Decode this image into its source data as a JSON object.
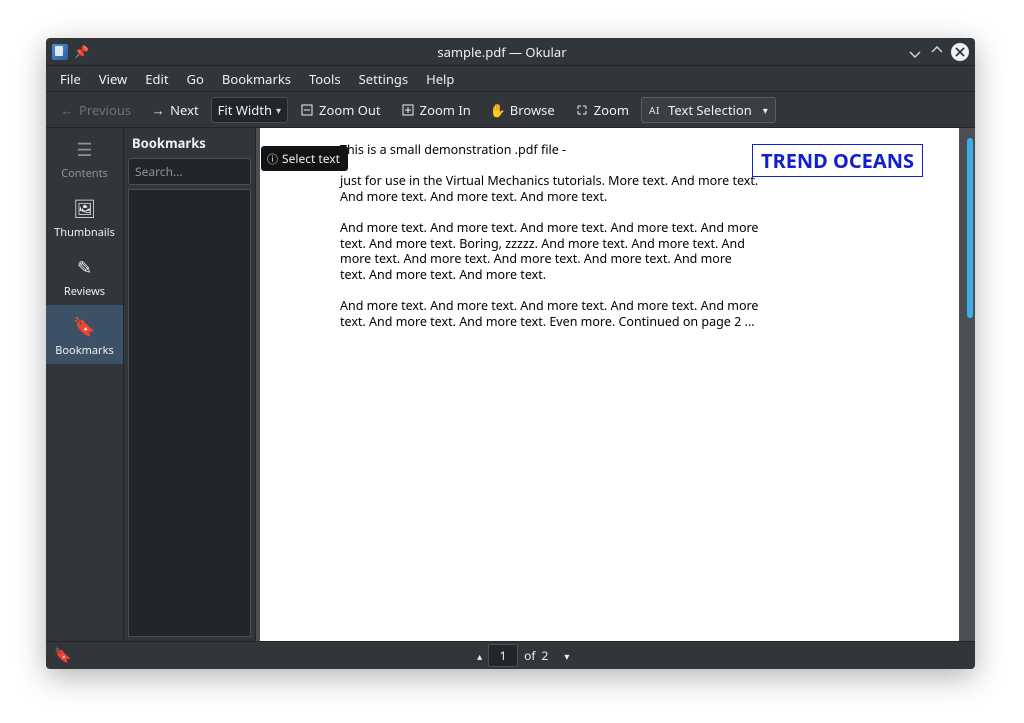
{
  "window": {
    "title": "sample.pdf — Okular"
  },
  "menubar": [
    "File",
    "View",
    "Edit",
    "Go",
    "Bookmarks",
    "Tools",
    "Settings",
    "Help"
  ],
  "toolbar": {
    "previous": "Previous",
    "next": "Next",
    "zoom_mode": "Fit Width",
    "zoom_out": "Zoom Out",
    "zoom_in": "Zoom In",
    "browse": "Browse",
    "zoom": "Zoom",
    "text_selection": "Text Selection"
  },
  "sidebar": {
    "items": [
      {
        "label": "Contents"
      },
      {
        "label": "Thumbnails"
      },
      {
        "label": "Reviews"
      },
      {
        "label": "Bookmarks"
      }
    ]
  },
  "panel": {
    "title": "Bookmarks",
    "search_placeholder": "Search..."
  },
  "tooltip": "Select text",
  "document": {
    "line1": "This is a small demonstration .pdf file -",
    "para1": "just for use in the Virtual Mechanics tutorials. More text. And more text. And more text. And more text. And more text.",
    "para2": "And more text. And more text. And more text. And more text. And more text. And more text. Boring, zzzzz. And more text. And more text. And more text. And more text. And more text. And more text. And more text. And more text. And more text.",
    "para3": "And more text. And more text. And more text. And more text. And more text. And more text. And more text. Even more. Continued on page 2 ...",
    "stamp": "TREND OCEANS"
  },
  "status": {
    "page": "1",
    "of_label": "of",
    "total": "2"
  }
}
